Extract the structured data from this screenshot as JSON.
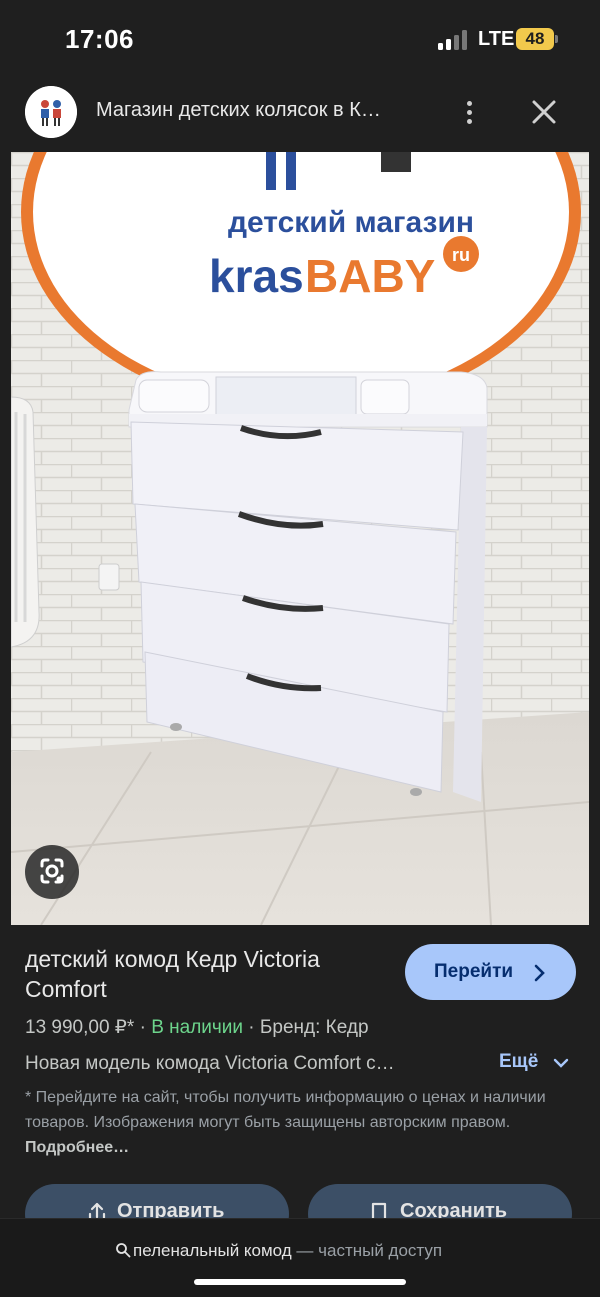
{
  "status": {
    "time": "17:06",
    "network": "LTE",
    "battery": "48"
  },
  "header": {
    "site_title": "Магазин детских колясок в К…",
    "menu_icon": "more-vert-icon",
    "close_icon": "close-icon"
  },
  "image": {
    "sign_line1": "детский магазин",
    "sign_brand_a": "kras",
    "sign_brand_b": "BABY",
    "sign_brand_c": "ru",
    "lens_icon": "google-lens-icon"
  },
  "product": {
    "title": "детский комод Кедр Victoria Comfort",
    "go_button": "Перейти",
    "price": "13 990,00 ₽*",
    "sep1": " · ",
    "stock": "В наличии",
    "sep2": " · ",
    "brand": "Бренд: Кедр",
    "description": "Новая модель комода Victoria Comfort с…",
    "more": "Ещё",
    "disclaimer": "* Перейдите на сайт, чтобы получить информацию о ценах и наличии товаров. Изображения могут быть защищены авторским правом. ",
    "details_link": "Подробнее…"
  },
  "actions": {
    "share": "Отправить",
    "save": "Сохранить"
  },
  "bottom": {
    "query": "пеленальный комод",
    "private": " — частный доступ"
  },
  "colors": {
    "accent": "#a8c7fa",
    "in_stock": "#6dd58c",
    "battery": "#f2c94c"
  }
}
